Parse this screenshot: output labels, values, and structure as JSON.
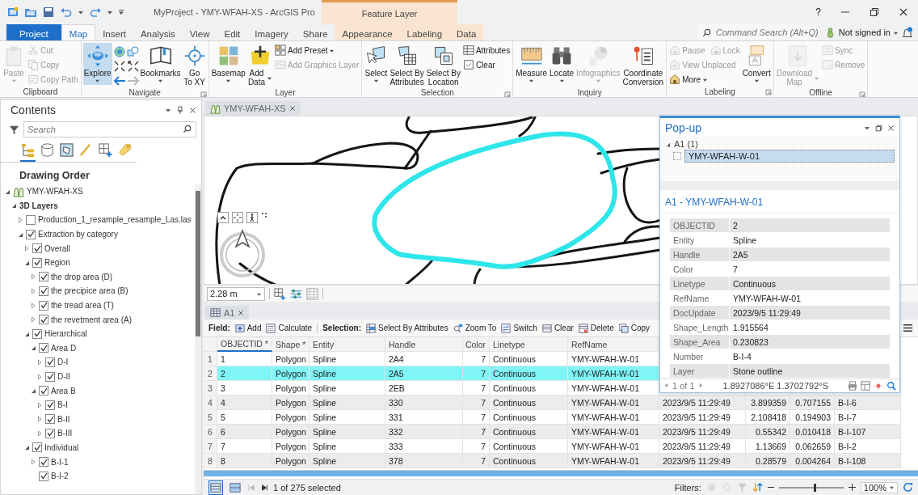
{
  "title_bar": {
    "title": "MyProject - YMY-WFAH-XS - ArcGIS Pro",
    "context_group": "Feature Layer",
    "help": "?"
  },
  "ribbon_tabs": [
    {
      "label": "Project",
      "kind": "backstage",
      "selected": false
    },
    {
      "label": "Map",
      "kind": "core",
      "selected": true
    },
    {
      "label": "Insert",
      "kind": "core",
      "selected": false
    },
    {
      "label": "Analysis",
      "kind": "core",
      "selected": false
    },
    {
      "label": "View",
      "kind": "core",
      "selected": false
    },
    {
      "label": "Edit",
      "kind": "core",
      "selected": false
    },
    {
      "label": "Imagery",
      "kind": "core",
      "selected": false
    },
    {
      "label": "Share",
      "kind": "core",
      "selected": false
    },
    {
      "label": "Appearance",
      "kind": "context",
      "selected": false
    },
    {
      "label": "Labeling",
      "kind": "context",
      "selected": false
    },
    {
      "label": "Data",
      "kind": "context",
      "selected": false
    }
  ],
  "command_search": {
    "placeholder": "Command Search (Alt+Q)"
  },
  "account": {
    "label": "Not signed in"
  },
  "ribbon_groups": [
    {
      "label": "Clipboard",
      "launcher": false,
      "buttons": [
        {
          "kind": "large",
          "label": "Paste",
          "dropdown": true,
          "disabled": true,
          "selected": false
        },
        {
          "kind": "stack",
          "rows": [
            [
              {
                "label": "Cut",
                "disabled": true
              }
            ],
            [
              {
                "label": "Copy",
                "disabled": true
              }
            ],
            [
              {
                "label": "Copy Path",
                "disabled": true
              }
            ]
          ]
        }
      ]
    },
    {
      "label": "Navigate",
      "launcher": true,
      "buttons": [
        {
          "kind": "large",
          "label": "Explore",
          "dropdown": true,
          "disabled": false,
          "selected": true
        },
        {
          "kind": "icon_grid"
        },
        {
          "kind": "large",
          "label": "Bookmarks",
          "dropdown": true,
          "disabled": false,
          "selected": false
        },
        {
          "kind": "large",
          "label": "Go\nTo XY",
          "dropdown": false,
          "disabled": false,
          "selected": false
        }
      ]
    },
    {
      "label": "Layer",
      "launcher": false,
      "buttons": [
        {
          "kind": "large",
          "label": "Basemap",
          "dropdown": true,
          "disabled": false,
          "selected": false
        },
        {
          "kind": "large",
          "label": "Add\nData",
          "dropdown": true,
          "disabled": false,
          "selected": false
        },
        {
          "kind": "stack",
          "rows": [
            [
              {
                "label": "Add Preset",
                "dropdown": true,
                "disabled": false
              }
            ],
            [
              {
                "label": "Add Graphics Layer",
                "disabled": true
              }
            ]
          ]
        }
      ]
    },
    {
      "label": "Selection",
      "launcher": true,
      "buttons": [
        {
          "kind": "large",
          "label": "Select",
          "dropdown": true,
          "disabled": false,
          "selected": false
        },
        {
          "kind": "large",
          "label": "Select By\nAttributes",
          "dropdown": false,
          "disabled": false,
          "selected": false
        },
        {
          "kind": "large",
          "label": "Select By\nLocation",
          "dropdown": false,
          "disabled": false,
          "selected": false
        },
        {
          "kind": "stack",
          "rows": [
            [
              {
                "label": "Attributes",
                "disabled": false
              }
            ],
            [
              {
                "label": "Clear",
                "disabled": false
              }
            ]
          ]
        }
      ]
    },
    {
      "label": "Inquiry",
      "launcher": false,
      "buttons": [
        {
          "kind": "large",
          "label": "Measure",
          "dropdown": true,
          "disabled": false,
          "selected": false
        },
        {
          "kind": "large",
          "label": "Locate",
          "dropdown": true,
          "disabled": false,
          "selected": false
        },
        {
          "kind": "large",
          "label": "Infographics",
          "dropdown": true,
          "disabled": true,
          "selected": false
        },
        {
          "kind": "large",
          "label": "Coordinate\nConversion",
          "dropdown": false,
          "disabled": false,
          "selected": false
        }
      ]
    },
    {
      "label": "Labeling",
      "launcher": true,
      "buttons": [
        {
          "kind": "stack",
          "rows": [
            [
              {
                "label": "Pause",
                "disabled": true
              },
              {
                "label": "Lock",
                "disabled": true
              }
            ],
            [
              {
                "label": "View Unplaced",
                "disabled": true
              }
            ],
            [
              {
                "label": "More",
                "dropdown": true,
                "disabled": false
              }
            ]
          ]
        },
        {
          "kind": "large",
          "label": "Convert",
          "dropdown": true,
          "disabled": false,
          "selected": false
        }
      ]
    },
    {
      "label": "Offline",
      "launcher": true,
      "buttons": [
        {
          "kind": "large",
          "label": "Download\nMap",
          "dropdown": true,
          "disabled": true,
          "selected": false
        },
        {
          "kind": "stack",
          "rows": [
            [
              {
                "label": "Sync",
                "disabled": true
              }
            ],
            [
              {
                "label": "Remove",
                "disabled": true
              }
            ]
          ]
        }
      ]
    }
  ],
  "contents": {
    "title": "Contents",
    "search": {
      "placeholder": "Search"
    },
    "view_tabs": [
      {
        "selected": true
      },
      {
        "selected": false
      },
      {
        "selected": false
      },
      {
        "selected": false
      },
      {
        "selected": false
      },
      {
        "selected": false
      }
    ],
    "heading": "Drawing Order",
    "tree": [
      {
        "label": "YMY-WFAH-XS",
        "kind": "map",
        "expanded": true,
        "children": [
          {
            "label": "3D Layers",
            "kind": "group",
            "expanded": true,
            "children": [
              {
                "label": "Production_1_resample_resample_Las.las",
                "kind": "layer",
                "expanded": false,
                "checked": false
              },
              {
                "label": "Extraction by category",
                "kind": "layer",
                "expanded": true,
                "checked": true,
                "children": [
                  {
                    "label": "Overall",
                    "kind": "layer",
                    "expanded": false,
                    "checked": true
                  },
                  {
                    "label": "Region",
                    "kind": "layer",
                    "expanded": true,
                    "checked": true,
                    "children": [
                      {
                        "label": "the drop area (D)",
                        "kind": "layer",
                        "expanded": false,
                        "checked": true
                      },
                      {
                        "label": "the precipice area (B)",
                        "kind": "layer",
                        "expanded": false,
                        "checked": true
                      },
                      {
                        "label": "the tread area  (T)",
                        "kind": "layer",
                        "expanded": false,
                        "checked": true
                      },
                      {
                        "label": "the revetment area  (A)",
                        "kind": "layer",
                        "expanded": false,
                        "checked": true
                      }
                    ]
                  },
                  {
                    "label": "Hierarchical",
                    "kind": "layer",
                    "expanded": true,
                    "checked": true,
                    "children": [
                      {
                        "label": "Area D",
                        "kind": "layer",
                        "expanded": true,
                        "checked": true,
                        "children": [
                          {
                            "label": "D-I",
                            "kind": "layer",
                            "expanded": false,
                            "checked": true
                          },
                          {
                            "label": "D-II",
                            "kind": "layer",
                            "expanded": false,
                            "checked": true
                          }
                        ]
                      },
                      {
                        "label": "Area B",
                        "kind": "layer",
                        "expanded": true,
                        "checked": true,
                        "children": [
                          {
                            "label": "B-I",
                            "kind": "layer",
                            "expanded": false,
                            "checked": true
                          },
                          {
                            "label": "B-II",
                            "kind": "layer",
                            "expanded": false,
                            "checked": true
                          },
                          {
                            "label": "B-III",
                            "kind": "layer",
                            "expanded": false,
                            "checked": true
                          }
                        ]
                      }
                    ]
                  },
                  {
                    "label": "Individual",
                    "kind": "layer",
                    "expanded": true,
                    "checked": true,
                    "children": [
                      {
                        "label": "B-I-1",
                        "kind": "layer",
                        "expanded": false,
                        "checked": true
                      },
                      {
                        "label": "B-I-2",
                        "kind": "layer",
                        "checked": true
                      }
                    ]
                  }
                ]
              }
            ]
          }
        ]
      }
    ]
  },
  "map_view": {
    "tab": {
      "label": "YMY-WFAH-XS",
      "selected": true
    },
    "scale": {
      "value": "2.28 m"
    }
  },
  "table": {
    "tab": {
      "label": "A1",
      "selected": true
    },
    "field_label": "Field:",
    "field_actions": [
      "Add",
      "Calculate"
    ],
    "selection_label": "Selection:",
    "selection_actions": [
      "Select By Attributes",
      "Zoom To",
      "Switch",
      "Clear",
      "Delete",
      "Copy"
    ],
    "columns": [
      "OBJECTID *",
      "Shape *",
      "Entity",
      "Handle",
      "Color",
      "Linetype",
      "RefName"
    ],
    "rows": [
      {
        "n": "1",
        "selected": false,
        "cells": [
          "1",
          "Polygon",
          "Spline",
          "2A4",
          "7",
          "Continuous",
          "YMY-WFAH-W-01"
        ]
      },
      {
        "n": "2",
        "selected": true,
        "cells": [
          "2",
          "Polygon",
          "Spline",
          "2A5",
          "7",
          "Continuous",
          "YMY-WFAH-W-01"
        ]
      },
      {
        "n": "3",
        "selected": false,
        "cells": [
          "3",
          "Polygon",
          "Spline",
          "2EB",
          "7",
          "Continuous",
          "YMY-WFAH-W-01"
        ]
      },
      {
        "n": "4",
        "selected": false,
        "cells": [
          "4",
          "Polygon",
          "Spline",
          "330",
          "7",
          "Continuous",
          "YMY-WFAH-W-01",
          "2023/9/5 11:29:49",
          "3.899359",
          "0.707155",
          "B-I-6"
        ]
      },
      {
        "n": "5",
        "selected": false,
        "cells": [
          "5",
          "Polygon",
          "Spline",
          "331",
          "7",
          "Continuous",
          "YMY-WFAH-W-01",
          "2023/9/5 11:29:49",
          "2.108418",
          "0.194903",
          "B-I-7"
        ]
      },
      {
        "n": "6",
        "selected": false,
        "cells": [
          "6",
          "Polygon",
          "Spline",
          "332",
          "7",
          "Continuous",
          "YMY-WFAH-W-01",
          "2023/9/5 11:29:49",
          "0.55342",
          "0.010418",
          "B-I-107"
        ]
      },
      {
        "n": "7",
        "selected": false,
        "cells": [
          "7",
          "Polygon",
          "Spline",
          "333",
          "7",
          "Continuous",
          "YMY-WFAH-W-01",
          "2023/9/5 11:29:49",
          "1.13669",
          "0.062659",
          "B-I-2"
        ]
      },
      {
        "n": "8",
        "selected": false,
        "cells": [
          "8",
          "Polygon",
          "Spline",
          "378",
          "7",
          "Continuous",
          "YMY-WFAH-W-01",
          "2023/9/5 11:29:49",
          "0.28579",
          "0.004264",
          "B-I-108"
        ]
      }
    ],
    "status": {
      "view_modes": [
        {
          "selected": true
        },
        {
          "selected": false
        }
      ],
      "selection_count": "1 of 275 selected",
      "filters_label": "Filters:",
      "zoom_slider": {
        "level": 0.55
      },
      "zoom": "100%"
    }
  },
  "popup": {
    "title": "Pop-up",
    "tree": {
      "label": "A1  (1)",
      "expanded": true,
      "children": [
        {
          "label": "YMY-WFAH-W-01",
          "selected": true
        }
      ]
    },
    "heading": "A1 - YMY-WFAH-W-01",
    "fields": [
      {
        "field": "OBJECTID",
        "value": "2"
      },
      {
        "field": "Entity",
        "value": "Spline"
      },
      {
        "field": "Handle",
        "value": "2A5"
      },
      {
        "field": "Color",
        "value": "7"
      },
      {
        "field": "Linetype",
        "value": "Continuous"
      },
      {
        "field": "RefName",
        "value": "YMY-WFAH-W-01"
      },
      {
        "field": "DocUpdate",
        "value": "2023/9/5 11:29:49"
      },
      {
        "field": "Shape_Length",
        "value": "1.915564"
      },
      {
        "field": "Shape_Area",
        "value": "0.230823"
      },
      {
        "field": "Number",
        "value": "B-I-4"
      },
      {
        "field": "Layer",
        "value": "Stone outline"
      }
    ],
    "pager": "1 of 1",
    "coordinates": "1.8927086°E 1.3702792°S"
  }
}
